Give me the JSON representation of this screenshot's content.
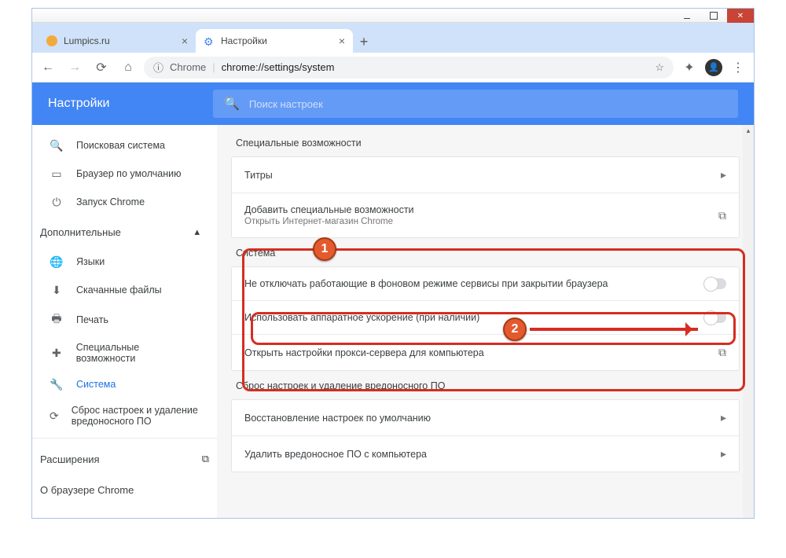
{
  "window": {
    "tab1": "Lumpics.ru",
    "tab2": "Настройки"
  },
  "addr": {
    "prefix": "Chrome",
    "url": "chrome://settings/system"
  },
  "header": {
    "title": "Настройки",
    "search_placeholder": "Поиск настроек"
  },
  "sidebar": {
    "items": [
      {
        "icon": "🔍",
        "label": "Поисковая система"
      },
      {
        "icon": "▭",
        "label": "Браузер по умолчанию"
      },
      {
        "icon": "⏻",
        "label": "Запуск Chrome"
      }
    ],
    "advanced_label": "Дополнительные",
    "adv_items": [
      {
        "icon": "🌐",
        "label": "Языки"
      },
      {
        "icon": "⬇",
        "label": "Скачанные файлы"
      },
      {
        "icon": "🖶",
        "label": "Печать"
      },
      {
        "icon": "✚",
        "label": "Специальные возможности"
      },
      {
        "icon": "🔧",
        "label": "Система",
        "active": true
      },
      {
        "icon": "⟳",
        "label": "Сброс настроек и удаление вредоносного ПО"
      }
    ],
    "extensions": "Расширения",
    "about": "О браузере Chrome"
  },
  "sections": {
    "a11y": {
      "title": "Специальные возможности",
      "row1": "Титры",
      "row2": "Добавить специальные возможности",
      "row2sub": "Открыть Интернет-магазин Chrome"
    },
    "system": {
      "title": "Система",
      "row_bg": "Не отключать работающие в фоновом режиме сервисы при закрытии браузера",
      "row_hw": "Использовать аппаратное ускорение (при наличии)",
      "row_proxy": "Открыть настройки прокси-сервера для компьютера"
    },
    "reset": {
      "title": "Сброс настроек и удаление вредоносного ПО",
      "row1": "Восстановление настроек по умолчанию",
      "row2": "Удалить вредоносное ПО с компьютера"
    }
  },
  "anno": {
    "n1": "1",
    "n2": "2"
  }
}
